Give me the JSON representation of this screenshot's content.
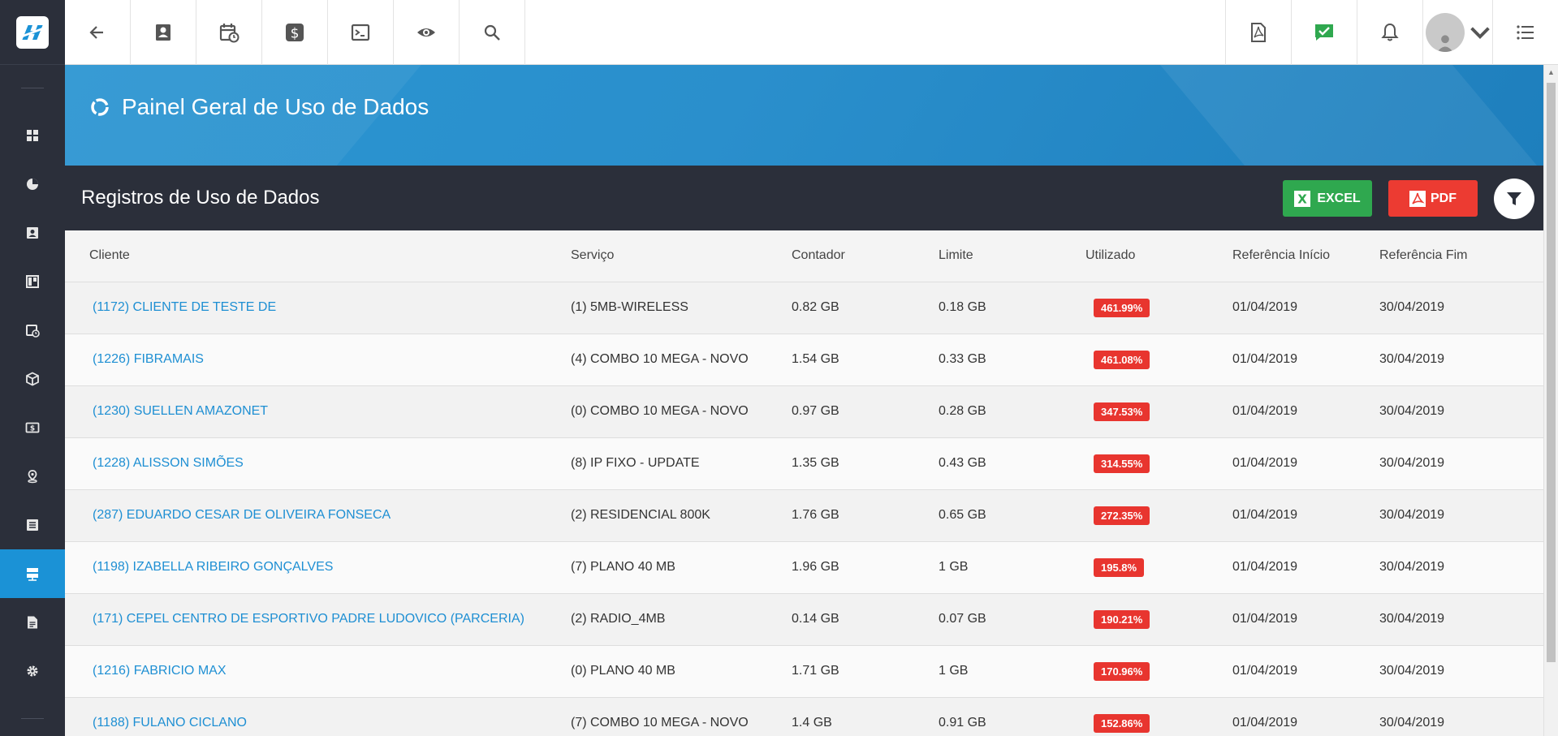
{
  "brand": {
    "logo_letter": "H",
    "color": "#1b92d6"
  },
  "sidebar": {
    "items": [
      {
        "icon": "dashboard-icon",
        "active": false
      },
      {
        "icon": "pie-chart-icon",
        "active": false
      },
      {
        "icon": "contact-card-icon",
        "active": false
      },
      {
        "icon": "board-icon",
        "active": false
      },
      {
        "icon": "calendar-clock-icon",
        "active": false
      },
      {
        "icon": "box-icon",
        "active": false
      },
      {
        "icon": "money-icon",
        "active": false
      },
      {
        "icon": "map-pin-icon",
        "active": false
      },
      {
        "icon": "list-icon",
        "active": false
      },
      {
        "icon": "server-icon",
        "active": true
      },
      {
        "icon": "document-icon",
        "active": false
      },
      {
        "icon": "gear-icon",
        "active": false
      }
    ]
  },
  "topbar": {
    "left_icons": [
      "back-arrow-icon",
      "contact-card-icon",
      "calendar-clock-icon",
      "dollar-icon",
      "terminal-icon",
      "eye-icon",
      "search-icon"
    ],
    "right_icons": [
      "pdf-file-icon",
      "check-message-icon",
      "bell-icon",
      "user-avatar-icon",
      "menu-list-icon"
    ]
  },
  "banner": {
    "title": "Painel Geral de Uso de Dados"
  },
  "panel": {
    "title": "Registros de Uso de Dados",
    "excel_label": "EXCEL",
    "pdf_label": "PDF"
  },
  "table": {
    "headers": {
      "cliente": "Cliente",
      "servico": "Serviço",
      "contador": "Contador",
      "limite": "Limite",
      "utilizado": "Utilizado",
      "ref_inicio": "Referência Início",
      "ref_fim": "Referência Fim"
    },
    "rows": [
      {
        "cliente": "(1172) CLIENTE DE TESTE DE",
        "servico": "(1) 5MB-WIRELESS",
        "contador": "0.82 GB",
        "limite": "0.18 GB",
        "utilizado": "461.99%",
        "inicio": "01/04/2019",
        "fim": "30/04/2019"
      },
      {
        "cliente": "(1226) FIBRAMAIS",
        "servico": "(4) COMBO 10 MEGA - NOVO",
        "contador": "1.54 GB",
        "limite": "0.33 GB",
        "utilizado": "461.08%",
        "inicio": "01/04/2019",
        "fim": "30/04/2019"
      },
      {
        "cliente": "(1230) SUELLEN AMAZONET",
        "servico": "(0) COMBO 10 MEGA - NOVO",
        "contador": "0.97 GB",
        "limite": "0.28 GB",
        "utilizado": "347.53%",
        "inicio": "01/04/2019",
        "fim": "30/04/2019"
      },
      {
        "cliente": "(1228) ALISSON SIMÕES",
        "servico": "(8) IP FIXO - UPDATE",
        "contador": "1.35 GB",
        "limite": "0.43 GB",
        "utilizado": "314.55%",
        "inicio": "01/04/2019",
        "fim": "30/04/2019"
      },
      {
        "cliente": "(287) EDUARDO CESAR DE OLIVEIRA FONSECA",
        "servico": "(2) RESIDENCIAL 800K",
        "contador": "1.76 GB",
        "limite": "0.65 GB",
        "utilizado": "272.35%",
        "inicio": "01/04/2019",
        "fim": "30/04/2019"
      },
      {
        "cliente": "(1198) IZABELLA RIBEIRO GONÇALVES",
        "servico": "(7) PLANO 40 MB",
        "contador": "1.96 GB",
        "limite": "1 GB",
        "utilizado": "195.8%",
        "inicio": "01/04/2019",
        "fim": "30/04/2019"
      },
      {
        "cliente": "(171) CEPEL CENTRO DE ESPORTIVO PADRE LUDOVICO (PARCERIA)",
        "servico": "(2) RADIO_4MB",
        "contador": "0.14 GB",
        "limite": "0.07 GB",
        "utilizado": "190.21%",
        "inicio": "01/04/2019",
        "fim": "30/04/2019"
      },
      {
        "cliente": "(1216) FABRICIO MAX",
        "servico": "(0) PLANO 40 MB",
        "contador": "1.71 GB",
        "limite": "1 GB",
        "utilizado": "170.96%",
        "inicio": "01/04/2019",
        "fim": "30/04/2019"
      },
      {
        "cliente": "(1188) FULANO CICLANO",
        "servico": "(7) COMBO 10 MEGA - NOVO",
        "contador": "1.4 GB",
        "limite": "0.91 GB",
        "utilizado": "152.86%",
        "inicio": "01/04/2019",
        "fim": "30/04/2019"
      }
    ]
  }
}
